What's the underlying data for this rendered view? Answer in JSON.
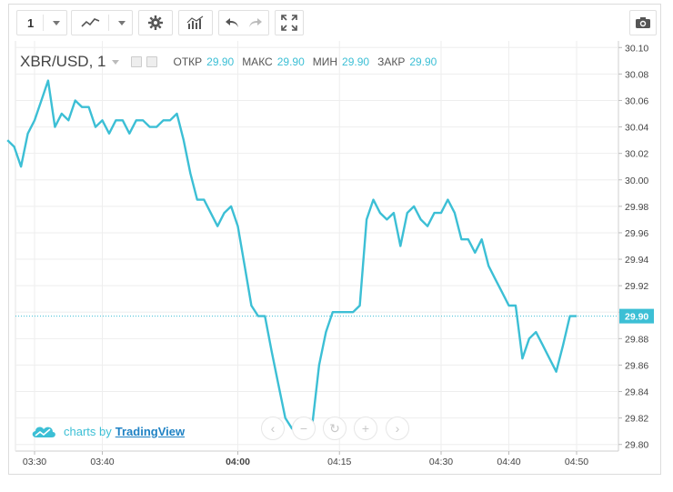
{
  "toolbar": {
    "interval_value": "1",
    "buttons": [
      "interval-dropdown",
      "chart-style",
      "indicators",
      "undo",
      "redo",
      "fullscreen",
      "snapshot"
    ]
  },
  "legend": {
    "symbol": "XBR/USD, 1",
    "open_label": "ОТКР",
    "open_value": "29.90",
    "high_label": "МАКС",
    "high_value": "29.90",
    "low_label": "МИН",
    "low_value": "29.90",
    "close_label": "ЗАКР",
    "close_value": "29.90"
  },
  "branding": {
    "prefix": "charts by",
    "name": "TradingView"
  },
  "nav": {
    "back": "‹",
    "zoom_out": "−",
    "reset": "↻",
    "zoom_in": "+",
    "forward": "›"
  },
  "colors": {
    "line": "#3cbfd5",
    "grid": "#eeeeee",
    "label": "#3cbfd5",
    "dotted": "#3cbfd5"
  },
  "chart_data": {
    "type": "line",
    "title": "",
    "xlabel": "",
    "ylabel": "",
    "ylim": [
      29.795,
      30.105
    ],
    "y_ticks": [
      "30.10",
      "30.08",
      "30.06",
      "30.04",
      "30.02",
      "30.00",
      "29.98",
      "29.96",
      "29.94",
      "29.92",
      "29.90",
      "29.88",
      "29.86",
      "29.84",
      "29.82",
      "29.80"
    ],
    "x_ticks": [
      {
        "label": "03:30",
        "t": "03:30",
        "bold": false
      },
      {
        "label": "03:40",
        "t": "03:40",
        "bold": false
      },
      {
        "label": "04:00",
        "t": "04:00",
        "bold": true
      },
      {
        "label": "04:15",
        "t": "04:15",
        "bold": false
      },
      {
        "label": "04:30",
        "t": "04:30",
        "bold": false
      },
      {
        "label": "04:40",
        "t": "04:40",
        "bold": false
      },
      {
        "label": "04:50",
        "t": "04:50",
        "bold": false
      }
    ],
    "last_price_label": "29.90",
    "last_price": 29.897,
    "series": [
      {
        "values": [
          [
            "03:26",
            30.03
          ],
          [
            "03:27",
            30.025
          ],
          [
            "03:28",
            30.01
          ],
          [
            "03:29",
            30.035
          ],
          [
            "03:30",
            30.045
          ],
          [
            "03:31",
            30.06
          ],
          [
            "03:32",
            30.075
          ],
          [
            "03:33",
            30.04
          ],
          [
            "03:34",
            30.05
          ],
          [
            "03:35",
            30.045
          ],
          [
            "03:36",
            30.06
          ],
          [
            "03:37",
            30.055
          ],
          [
            "03:38",
            30.055
          ],
          [
            "03:39",
            30.04
          ],
          [
            "03:40",
            30.045
          ],
          [
            "03:41",
            30.035
          ],
          [
            "03:42",
            30.045
          ],
          [
            "03:43",
            30.045
          ],
          [
            "03:44",
            30.035
          ],
          [
            "03:45",
            30.045
          ],
          [
            "03:46",
            30.045
          ],
          [
            "03:47",
            30.04
          ],
          [
            "03:48",
            30.04
          ],
          [
            "03:49",
            30.045
          ],
          [
            "03:50",
            30.045
          ],
          [
            "03:51",
            30.05
          ],
          [
            "03:52",
            30.03
          ],
          [
            "03:53",
            30.005
          ],
          [
            "03:54",
            29.985
          ],
          [
            "03:55",
            29.985
          ],
          [
            "03:56",
            29.975
          ],
          [
            "03:57",
            29.965
          ],
          [
            "03:58",
            29.975
          ],
          [
            "03:59",
            29.98
          ],
          [
            "04:00",
            29.965
          ],
          [
            "04:01",
            29.935
          ],
          [
            "04:02",
            29.905
          ],
          [
            "04:03",
            29.897
          ],
          [
            "04:04",
            29.897
          ],
          [
            "04:05",
            29.87
          ],
          [
            "04:06",
            29.845
          ],
          [
            "04:07",
            29.82
          ],
          [
            "04:08",
            29.812
          ],
          [
            "04:09",
            29.81
          ],
          [
            "04:10",
            29.81
          ],
          [
            "04:11",
            29.815
          ],
          [
            "04:12",
            29.86
          ],
          [
            "04:13",
            29.885
          ],
          [
            "04:14",
            29.9
          ],
          [
            "04:15",
            29.9
          ],
          [
            "04:16",
            29.9
          ],
          [
            "04:17",
            29.9
          ],
          [
            "04:18",
            29.905
          ],
          [
            "04:19",
            29.97
          ],
          [
            "04:20",
            29.985
          ],
          [
            "04:21",
            29.975
          ],
          [
            "04:22",
            29.97
          ],
          [
            "04:23",
            29.975
          ],
          [
            "04:24",
            29.95
          ],
          [
            "04:25",
            29.975
          ],
          [
            "04:26",
            29.98
          ],
          [
            "04:27",
            29.97
          ],
          [
            "04:28",
            29.965
          ],
          [
            "04:29",
            29.975
          ],
          [
            "04:30",
            29.975
          ],
          [
            "04:31",
            29.985
          ],
          [
            "04:32",
            29.975
          ],
          [
            "04:33",
            29.955
          ],
          [
            "04:34",
            29.955
          ],
          [
            "04:35",
            29.945
          ],
          [
            "04:36",
            29.955
          ],
          [
            "04:37",
            29.935
          ],
          [
            "04:38",
            29.925
          ],
          [
            "04:39",
            29.915
          ],
          [
            "04:40",
            29.905
          ],
          [
            "04:41",
            29.905
          ],
          [
            "04:42",
            29.865
          ],
          [
            "04:43",
            29.88
          ],
          [
            "04:44",
            29.885
          ],
          [
            "04:45",
            29.875
          ],
          [
            "04:46",
            29.865
          ],
          [
            "04:47",
            29.855
          ],
          [
            "04:48",
            29.875
          ],
          [
            "04:49",
            29.897
          ],
          [
            "04:50",
            29.897
          ]
        ]
      }
    ]
  }
}
